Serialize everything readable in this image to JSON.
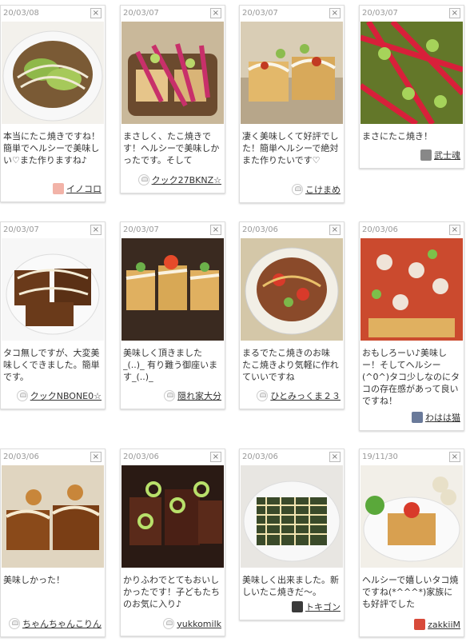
{
  "close_label": "×",
  "cards": [
    {
      "date": "20/03/08",
      "comment": "本当にたこ焼きですね！簡単でヘルシーで美味しい♡また作りますね♪",
      "author": "イノコロ",
      "avatar": "photo-pink"
    },
    {
      "date": "20/03/07",
      "comment": "まさしく、たこ焼きです！ヘルシーで美味しかったです。そして",
      "author": "クック27BKNZ☆",
      "avatar": "chef"
    },
    {
      "date": "20/03/07",
      "comment": "凄く美味しくて好評でした！簡単ヘルシーで絶対また作りたいです♡",
      "author": "こけまめ",
      "avatar": "chef"
    },
    {
      "date": "20/03/07",
      "comment": "まさにたこ焼き！",
      "author": "武士魂",
      "avatar": "photo-gray"
    },
    {
      "date": "20/03/07",
      "comment": "タコ無しですが、大変美味しくできました。簡単です。",
      "author": "クックNBONE0☆",
      "avatar": "chef"
    },
    {
      "date": "20/03/07",
      "comment": "美味しく頂きました_(..)_ 有り難う御座います_(..)_",
      "author": "隠れ家大分",
      "avatar": "chef"
    },
    {
      "date": "20/03/06",
      "comment": "まるでたこ焼きのお味 たこ焼きより気軽に作れていいですね",
      "author": "ひとみっくま２３",
      "avatar": "chef"
    },
    {
      "date": "20/03/06",
      "comment": "おもしろーい♪美味しー！そしてヘルシー(^0^)タコ少しなのにタコの存在感があって良いですね！",
      "author": "わはは猫",
      "avatar": "photo-blue"
    },
    {
      "date": "20/03/06",
      "comment": "美味しかった！",
      "author": "ちゃんちゃんこりん",
      "avatar": "chef"
    },
    {
      "date": "20/03/06",
      "comment": "かりふわでとてもおいしかったです！子どもたちのお気に入り♪",
      "author": "yukkomilk",
      "avatar": "chef"
    },
    {
      "date": "20/03/06",
      "comment": "美味しく出来ました。新しいたこ焼きだ〜。",
      "author": "トキゴン",
      "avatar": "photo-dark"
    },
    {
      "date": "19/11/30",
      "comment": "ヘルシーで嬉しいタコ焼ですね(*^^^*)家族にも好評でした",
      "author": "zakkiiM",
      "avatar": "photo-red"
    }
  ],
  "colors": {
    "accent": "#c8a36a",
    "text": "#333333",
    "date": "#999999"
  }
}
